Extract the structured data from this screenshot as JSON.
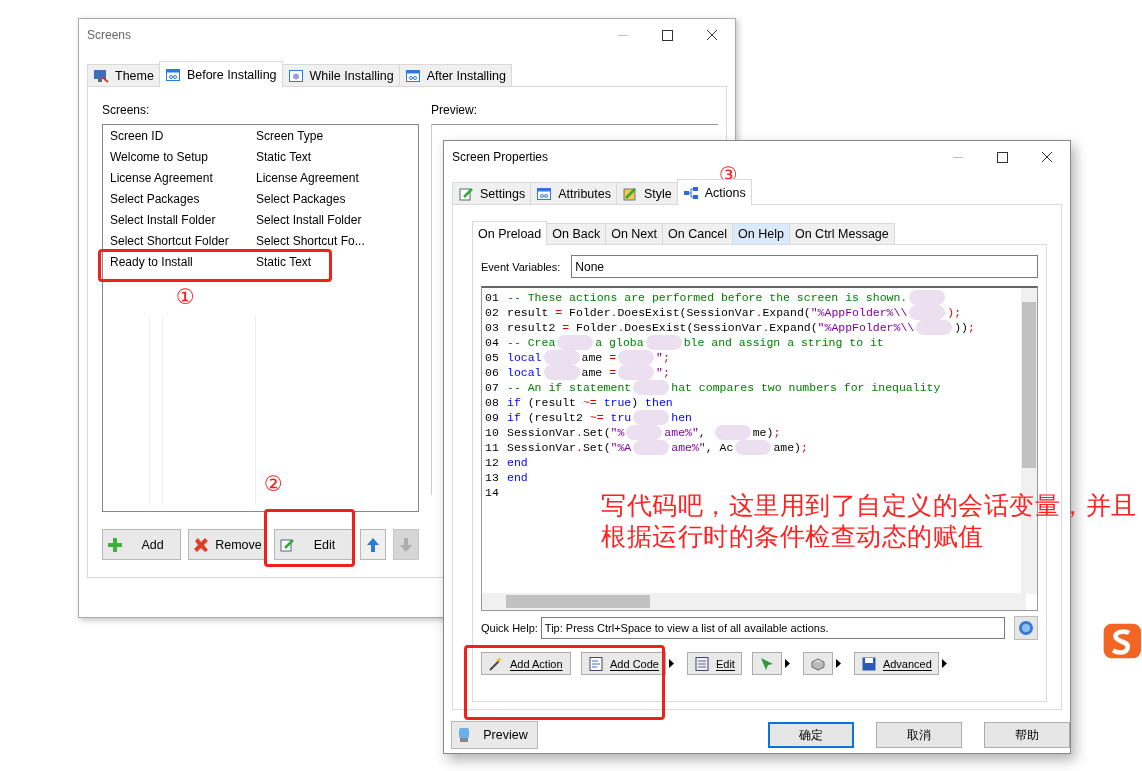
{
  "screens_window": {
    "title": "Screens",
    "tabs": [
      {
        "label": "Theme",
        "selected": false
      },
      {
        "label": "Before Installing",
        "selected": true
      },
      {
        "label": "While Installing",
        "selected": false
      },
      {
        "label": "After Installing",
        "selected": false
      }
    ],
    "screens_label": "Screens:",
    "preview_label": "Preview:",
    "columns": [
      "Screen ID",
      "Screen Type"
    ],
    "rows": [
      {
        "id": "Welcome to Setup",
        "type": "Static Text"
      },
      {
        "id": "License Agreement",
        "type": "License Agreement"
      },
      {
        "id": "Select Packages",
        "type": "Select Packages"
      },
      {
        "id": "Select Install Folder",
        "type": "Select Install Folder"
      },
      {
        "id": "Select Shortcut Folder",
        "type": "Select Shortcut Fo..."
      },
      {
        "id": "Ready to Install",
        "type": "Static Text"
      }
    ],
    "buttons": [
      {
        "label": "Add",
        "disabled": false
      },
      {
        "label": "Remove",
        "disabled": false
      },
      {
        "label": "Edit",
        "disabled": false
      }
    ],
    "arrow_buttons": [
      {
        "disabled": false
      },
      {
        "disabled": true
      }
    ]
  },
  "properties_window": {
    "title": "Screen Properties",
    "tabs": [
      {
        "label": "Settings",
        "selected": false
      },
      {
        "label": "Attributes",
        "selected": false
      },
      {
        "label": "Style",
        "selected": false
      },
      {
        "label": "Actions",
        "selected": true
      }
    ],
    "event_tabs": [
      {
        "label": "On Preload",
        "selected": true,
        "highlighted": false
      },
      {
        "label": "On Back",
        "selected": false,
        "highlighted": false
      },
      {
        "label": "On Next",
        "selected": false,
        "highlighted": false
      },
      {
        "label": "On Cancel",
        "selected": false,
        "highlighted": false
      },
      {
        "label": "On Help",
        "selected": false,
        "highlighted": true
      },
      {
        "label": "On Ctrl Message",
        "selected": false,
        "highlighted": false
      }
    ],
    "event_variables_label": "Event Variables:",
    "event_variables": "None",
    "code_lines": [
      {
        "number": "01",
        "segments": [
          {
            "kind": "comment",
            "text": "-- These actions are performed before the screen is shown."
          },
          {
            "kind": "blur"
          }
        ]
      },
      {
        "number": "02",
        "segments": [
          {
            "kind": "plain",
            "text": "result "
          },
          {
            "kind": "op",
            "text": "="
          },
          {
            "kind": "plain",
            "text": " Folder"
          },
          {
            "kind": "op",
            "text": "."
          },
          {
            "kind": "plain",
            "text": "DoesExist(SessionVar"
          },
          {
            "kind": "op",
            "text": "."
          },
          {
            "kind": "plain",
            "text": "Expand("
          },
          {
            "kind": "string",
            "text": "\"%AppFolder%\\\\"
          },
          {
            "kind": "blur"
          },
          {
            "kind": "op",
            "text": ");"
          }
        ]
      },
      {
        "number": "03",
        "segments": [
          {
            "kind": "plain",
            "text": "result2 "
          },
          {
            "kind": "op",
            "text": "="
          },
          {
            "kind": "plain",
            "text": " Folder"
          },
          {
            "kind": "op",
            "text": "."
          },
          {
            "kind": "plain",
            "text": "DoesExist(SessionVar"
          },
          {
            "kind": "op",
            "text": "."
          },
          {
            "kind": "plain",
            "text": "Expand("
          },
          {
            "kind": "string",
            "text": "\"%AppFolder%\\\\"
          },
          {
            "kind": "blur"
          },
          {
            "kind": "plain",
            "text": "))"
          },
          {
            "kind": "op",
            "text": ";"
          }
        ]
      },
      {
        "number": "04",
        "segments": [
          {
            "kind": "comment",
            "text": "-- Crea"
          },
          {
            "kind": "blur"
          },
          {
            "kind": "comment",
            "text": "a globa"
          },
          {
            "kind": "blur"
          },
          {
            "kind": "comment",
            "text": "ble and assign a string to it"
          }
        ]
      },
      {
        "number": "05",
        "segments": [
          {
            "kind": "keyword",
            "text": "local"
          },
          {
            "kind": "blur"
          },
          {
            "kind": "plain",
            "text": "ame "
          },
          {
            "kind": "op",
            "text": "="
          },
          {
            "kind": "blur"
          },
          {
            "kind": "string",
            "text": "\""
          },
          {
            "kind": "op",
            "text": ";"
          }
        ]
      },
      {
        "number": "06",
        "segments": [
          {
            "kind": "keyword",
            "text": "local"
          },
          {
            "kind": "blur"
          },
          {
            "kind": "plain",
            "text": "ame "
          },
          {
            "kind": "op",
            "text": "="
          },
          {
            "kind": "blur"
          },
          {
            "kind": "string",
            "text": "\""
          },
          {
            "kind": "op",
            "text": ";"
          }
        ]
      },
      {
        "number": "07",
        "segments": [
          {
            "kind": "comment",
            "text": "-- An if statement"
          },
          {
            "kind": "blur"
          },
          {
            "kind": "comment",
            "text": "hat compares two numbers for inequality"
          }
        ]
      },
      {
        "number": "08",
        "segments": [
          {
            "kind": "keyword",
            "text": "if"
          },
          {
            "kind": "plain",
            "text": " (result "
          },
          {
            "kind": "op",
            "text": "~="
          },
          {
            "kind": "keyword",
            "text": " true"
          },
          {
            "kind": "plain",
            "text": ") "
          },
          {
            "kind": "keyword",
            "text": "then"
          }
        ]
      },
      {
        "number": "09",
        "segments": [
          {
            "kind": "keyword",
            "text": "if"
          },
          {
            "kind": "plain",
            "text": " (result2 "
          },
          {
            "kind": "op",
            "text": "~="
          },
          {
            "kind": "keyword",
            "text": " tru"
          },
          {
            "kind": "blur"
          },
          {
            "kind": "keyword",
            "text": "hen"
          }
        ]
      },
      {
        "number": "10",
        "segments": [
          {
            "kind": "plain",
            "text": "SessionVar"
          },
          {
            "kind": "op",
            "text": "."
          },
          {
            "kind": "plain",
            "text": "Set("
          },
          {
            "kind": "string",
            "text": "\"%"
          },
          {
            "kind": "blur"
          },
          {
            "kind": "string",
            "text": "ame%\""
          },
          {
            "kind": "plain",
            "text": ", "
          },
          {
            "kind": "blur"
          },
          {
            "kind": "plain",
            "text": "me)"
          },
          {
            "kind": "op",
            "text": ";"
          }
        ]
      },
      {
        "number": "11",
        "segments": [
          {
            "kind": "plain",
            "text": "SessionVar"
          },
          {
            "kind": "op",
            "text": "."
          },
          {
            "kind": "plain",
            "text": "Set("
          },
          {
            "kind": "string",
            "text": "\"%A"
          },
          {
            "kind": "blur"
          },
          {
            "kind": "string",
            "text": "ame%\""
          },
          {
            "kind": "plain",
            "text": ", Ac"
          },
          {
            "kind": "blur"
          },
          {
            "kind": "plain",
            "text": "ame)"
          },
          {
            "kind": "op",
            "text": ";"
          }
        ]
      },
      {
        "number": "12",
        "segments": [
          {
            "kind": "keyword",
            "text": "end"
          }
        ]
      },
      {
        "number": "13",
        "segments": [
          {
            "kind": "keyword",
            "text": "end"
          }
        ]
      },
      {
        "number": "14"
      }
    ],
    "quick_help_label": "Quick Help:",
    "quick_help": "Tip: Press Ctrl+Space to view a list of all available actions.",
    "action_buttons": [
      {
        "label": "Add Action",
        "menu": false
      },
      {
        "label": "Add Code",
        "menu": true
      },
      {
        "label": "Edit",
        "menu": false
      },
      {
        "menu": true
      },
      {
        "menu": true
      },
      {
        "label": "Advanced",
        "menu": true
      }
    ],
    "preview_button": "Preview",
    "dialog_buttons": [
      {
        "label": "确定",
        "default": true
      },
      {
        "label": "取消",
        "default": false
      },
      {
        "label": "帮助",
        "default": false
      }
    ]
  },
  "annotations": {
    "markers": [
      "①",
      "②",
      "③"
    ],
    "note": "写代码吧，这里用到了自定义的会话变量，并且根据运行时的条件检查动态的赋值"
  }
}
